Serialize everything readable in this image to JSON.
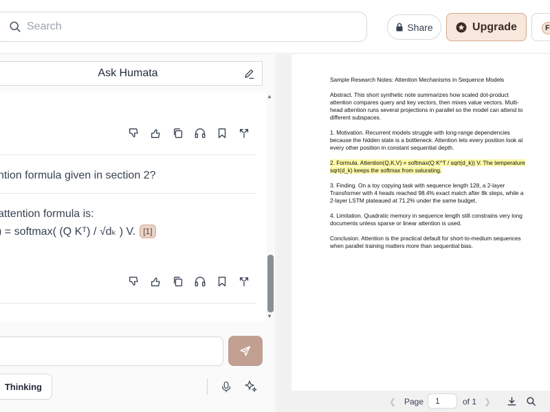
{
  "header": {
    "search_placeholder": "Search",
    "share_label": "Share",
    "upgrade_label": "Upgrade",
    "extra_button_initial": "F"
  },
  "chat": {
    "title": "Ask Humata",
    "question_text": "ntion formula given in section 2?",
    "answer_line1": "attention formula is:",
    "answer_line2": ") = softmax( (Q Kᵀ) / √dₖ ) V.",
    "citation": "[1]",
    "composer_placeholder": "",
    "thinking_label": "Thinking"
  },
  "pdf": {
    "title": "Sample Research Notes: Attention Mechanisms in Sequence Models",
    "abstract": "Abstract. This short synthetic note summarizes how scaled dot-product attention compares query and key vectors, then mixes value vectors. Multi-head attention runs several projections in parallel so the model can attend to different subspaces.",
    "motivation": "1. Motivation. Recurrent models struggle with long-range dependencies because the hidden state is a bottleneck. Attention lets every position look at every other position in constant sequential depth.",
    "formula": "2. Formula. Attention(Q,K,V) = softmax(Q K^T / sqrt(d_k)) V. The temperature sqrt(d_k) keeps the softmax from saturating.",
    "finding": "3. Finding. On a toy copying task with sequence length 128, a 2-layer Transformer with 4 heads reached 98.4% exact match after 8k steps, while a 2-layer LSTM plateaued at 71.2% under the same budget.",
    "limitation": "4. Limitation. Quadratic memory in sequence length still constrains very long documents unless sparse or linear attention is used.",
    "conclusion": "Conclusion. Attention is the practical default for short-to-medium sequences when parallel training matters more than sequential bias.",
    "page_label": "Page",
    "page_value": "1",
    "page_of": "of 1"
  },
  "colors": {
    "accent": "#f8e7dd",
    "accent_border": "#d6a68a",
    "send_button": "#c1a091",
    "highlight": "#fcf8a4"
  },
  "icons": {
    "action_row": [
      "thumbs-down-icon",
      "thumbs-up-icon",
      "copy-icon",
      "headphones-icon",
      "bookmark-icon",
      "expand-icon"
    ]
  }
}
